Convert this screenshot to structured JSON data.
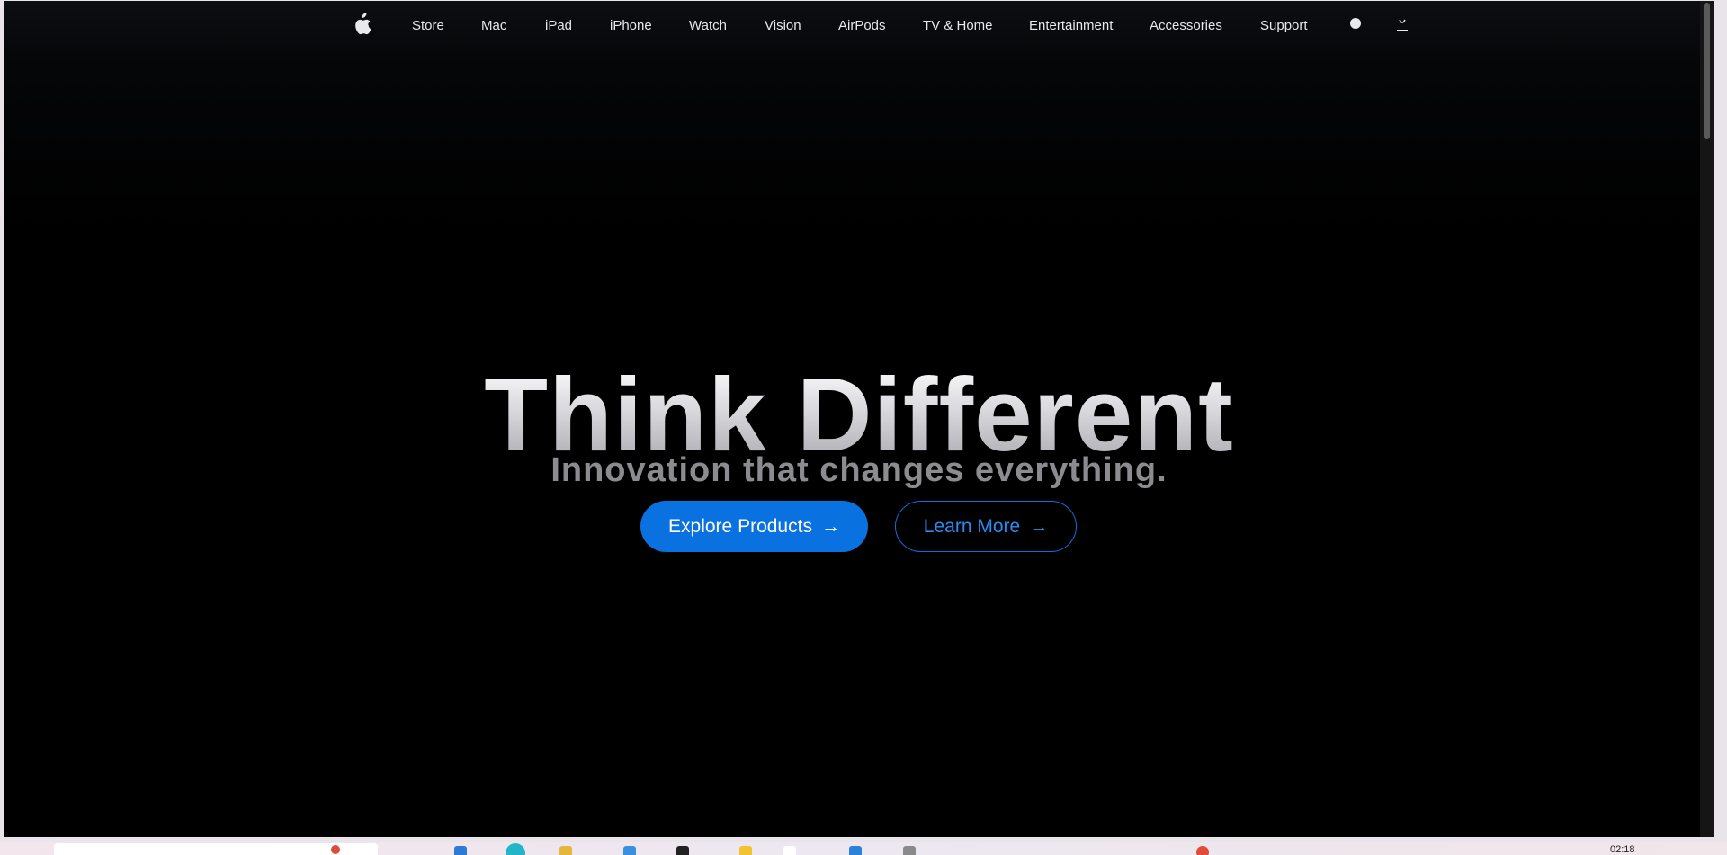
{
  "nav": {
    "items": [
      {
        "label": "Store"
      },
      {
        "label": "Mac"
      },
      {
        "label": "iPad"
      },
      {
        "label": "iPhone"
      },
      {
        "label": "Watch"
      },
      {
        "label": "Vision"
      },
      {
        "label": "AirPods"
      },
      {
        "label": "TV & Home"
      },
      {
        "label": "Entertainment"
      },
      {
        "label": "Accessories"
      },
      {
        "label": "Support"
      }
    ],
    "icons": [
      "apple-logo-icon",
      "search-icon",
      "bag-icon"
    ]
  },
  "hero": {
    "title": "Think Different",
    "subtitle": "Innovation that changes everything.",
    "primary_button": {
      "label": "Explore Products",
      "arrow": "→"
    },
    "secondary_button": {
      "label": "Learn More",
      "arrow": "→"
    }
  },
  "colors": {
    "background": "#000000",
    "accent": "#0a71e0",
    "nav_text": "#e8e8ed",
    "subtitle": "#8b8b90"
  },
  "taskbar": {
    "clock": "02:18"
  }
}
